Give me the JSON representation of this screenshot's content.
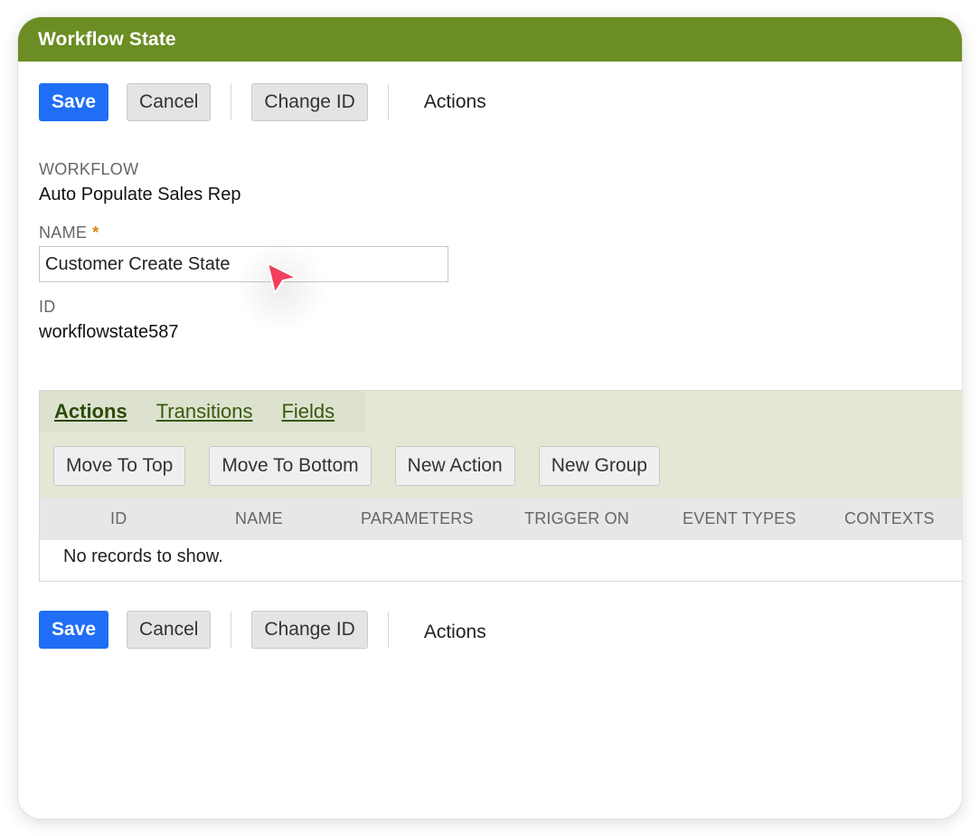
{
  "window": {
    "title": "Workflow State"
  },
  "toolbar": {
    "save_label": "Save",
    "cancel_label": "Cancel",
    "change_id_label": "Change ID",
    "actions_label": "Actions"
  },
  "form": {
    "workflow_label": "WORKFLOW",
    "workflow_value": "Auto Populate Sales Rep",
    "name_label": "NAME",
    "name_required_marker": "*",
    "name_value": "Customer Create State",
    "id_label": "ID",
    "id_value": "workflowstate587"
  },
  "subtabs": {
    "tabs": [
      {
        "label": "Actions",
        "active": true
      },
      {
        "label": "Transitions",
        "active": false
      },
      {
        "label": "Fields",
        "active": false
      }
    ],
    "buttons": {
      "move_to_top": "Move To Top",
      "move_to_bottom": "Move To Bottom",
      "new_action": "New Action",
      "new_group": "New Group"
    },
    "columns": [
      "ID",
      "NAME",
      "PARAMETERS",
      "TRIGGER ON",
      "EVENT TYPES",
      "CONTEXTS"
    ],
    "empty_message": "No records to show."
  },
  "colors": {
    "title_bar": "#6b8d23",
    "primary_button": "#1f6ef5",
    "tab_background": "#e3e8d4",
    "required_marker": "#d4860b",
    "cursor": "#f0405c"
  },
  "icons": {
    "pointer": "mouse-pointer-icon"
  }
}
